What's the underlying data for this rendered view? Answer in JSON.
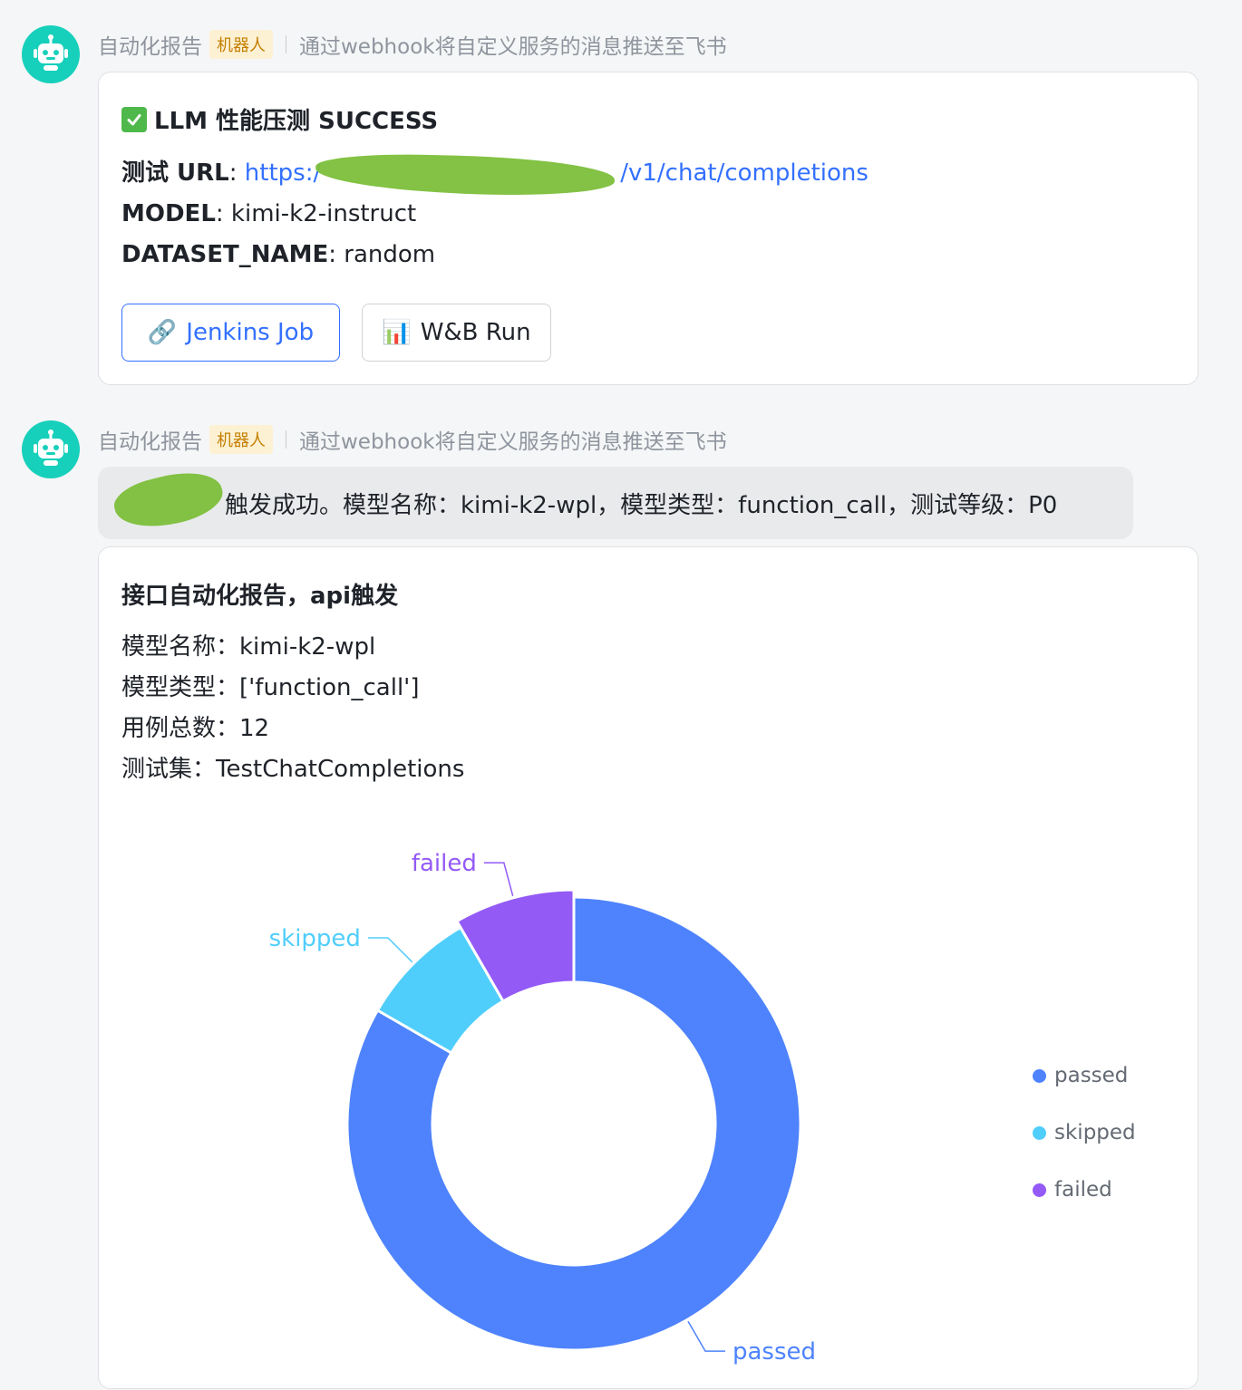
{
  "messages": [
    {
      "sender": "自动化报告",
      "badge": "机器人",
      "description": "通过webhook将自定义服务的消息推送至飞书",
      "card": {
        "title": "LLM 性能压测 SUCCESS",
        "fields": [
          {
            "label": "测试 URL",
            "sep": ": ",
            "value_start": "https:/",
            "value_end": "/v1/chat/completions"
          },
          {
            "label": "MODEL",
            "sep": ": ",
            "value": "kimi-k2-instruct"
          },
          {
            "label": "DATASET_NAME",
            "sep": ": ",
            "value": "random"
          }
        ],
        "buttons": [
          {
            "icon": "🔗",
            "label": "Jenkins Job"
          },
          {
            "icon": "📊",
            "label": "W&B Run"
          }
        ]
      }
    },
    {
      "sender": "自动化报告",
      "badge": "机器人",
      "description": "通过webhook将自定义服务的消息推送至飞书",
      "bubble_text": "触发成功。模型名称：kimi-k2-wpl，模型类型：function_call，测试等级：P0",
      "card": {
        "title": "接口自动化报告，api触发",
        "lines": [
          "模型名称：kimi-k2-wpl",
          "模型类型：['function_call']",
          "用例总数：12",
          "测试集：TestChatCompletions"
        ]
      }
    }
  ],
  "chart_data": {
    "type": "pie",
    "donut": true,
    "categories": [
      "passed",
      "skipped",
      "failed"
    ],
    "values": [
      10,
      1,
      1
    ],
    "colors": [
      "#4e83fd",
      "#50cefb",
      "#935af6"
    ],
    "legend_position": "right"
  },
  "colors": {
    "link": "#3370ff",
    "avatar": "#17d0bb",
    "success": "#4eb84b"
  }
}
